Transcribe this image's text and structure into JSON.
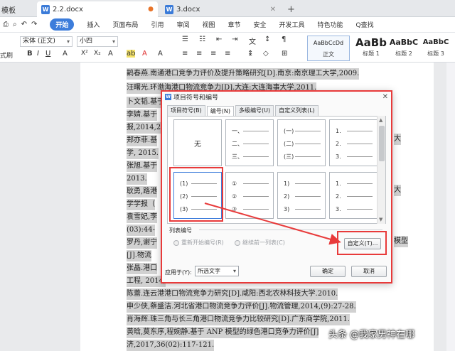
{
  "tabs": {
    "first": "模板",
    "active": "2.2.docx",
    "second": "3.docx",
    "add": "+"
  },
  "menu": [
    "开始",
    "插入",
    "页面布局",
    "引用",
    "审阅",
    "视图",
    "章节",
    "安全",
    "开发工具",
    "特色功能",
    "Q查找"
  ],
  "ribbon": {
    "font_name": "宋体 (正文)",
    "font_size": "小四",
    "format_label": "式刷",
    "styles": [
      {
        "sample": "AaBbCcDd",
        "name": "正文"
      },
      {
        "sample": "AaBb",
        "name": "标题 1"
      },
      {
        "sample": "AaBbC",
        "name": "标题 2"
      },
      {
        "sample": "AaBbC",
        "name": "标题 3"
      }
    ]
  },
  "document_lines": [
    "鹋春燕.南通港口竞争力评价及提升策略研究[D].南京:南京理工大学,2009.",
    "汪曙光.环渤海港口物流竞争力[D].大连:大连海事大学,2011.",
    "卜文韬.基于",
    "李婧.基于",
    "报,2014,2",
    "郑亦菲.基",
    "学, 2015.",
    "张旭.基于",
    "2013.",
    "耿勇,路港",
    "学学报（",
    "袁雪妃,李",
    "(03):44-",
    "罗丹,谢宁",
    "[J].物流",
    "张晶.港口",
    "工程, 2014,",
    "陈蕾.连云港港口物流竞争力研究[D].咸阳:西北农林科技大学.2010.",
    "申少侠,蔡盛洁.河北省港口物流竞争力评价[J].物流管理,2014,(9):27-28.",
    "肖海辉.珠三角与长三角港口物流竞争力比较研究[D].广东商学院,2011.",
    "黄晗,莫东序,程婉静.基于 ANP 模型的绿色港口竞争力评价[J]",
    "济,2017,36(02):117-121."
  ],
  "side_fragments": [
    "大",
    "大",
    "模型"
  ],
  "dialog": {
    "title": "项目符号和编号",
    "tabs": [
      "项目符号(B)",
      "编号(N)",
      "多级编号(U)",
      "自定义列表(L)"
    ],
    "none_label": "无",
    "cells": [
      [
        "一、",
        "二、",
        "三、"
      ],
      [
        "(一)",
        "(二)",
        "(三)"
      ],
      [
        "1.",
        "2.",
        "3."
      ],
      [
        "(1)",
        "(2)",
        "(3)"
      ],
      [
        "①",
        "②",
        "③"
      ],
      [
        "1)",
        "2)",
        "3)"
      ],
      [
        "1.",
        "2.",
        "3."
      ]
    ],
    "group_label": "列表编号",
    "radio_restart": "重新开始编号(R)",
    "radio_continue": "继续前一列表(C)",
    "custom_button": "自定义(T)...",
    "apply_label": "应用于(Y):",
    "apply_value": "所选文字",
    "ok": "确定",
    "cancel": "取消"
  },
  "watermark": "头条 @我家男神在哪",
  "colors": {
    "accent": "#3d7ddb",
    "highlight": "#e83a3a",
    "selection": "#d1d1d1"
  }
}
